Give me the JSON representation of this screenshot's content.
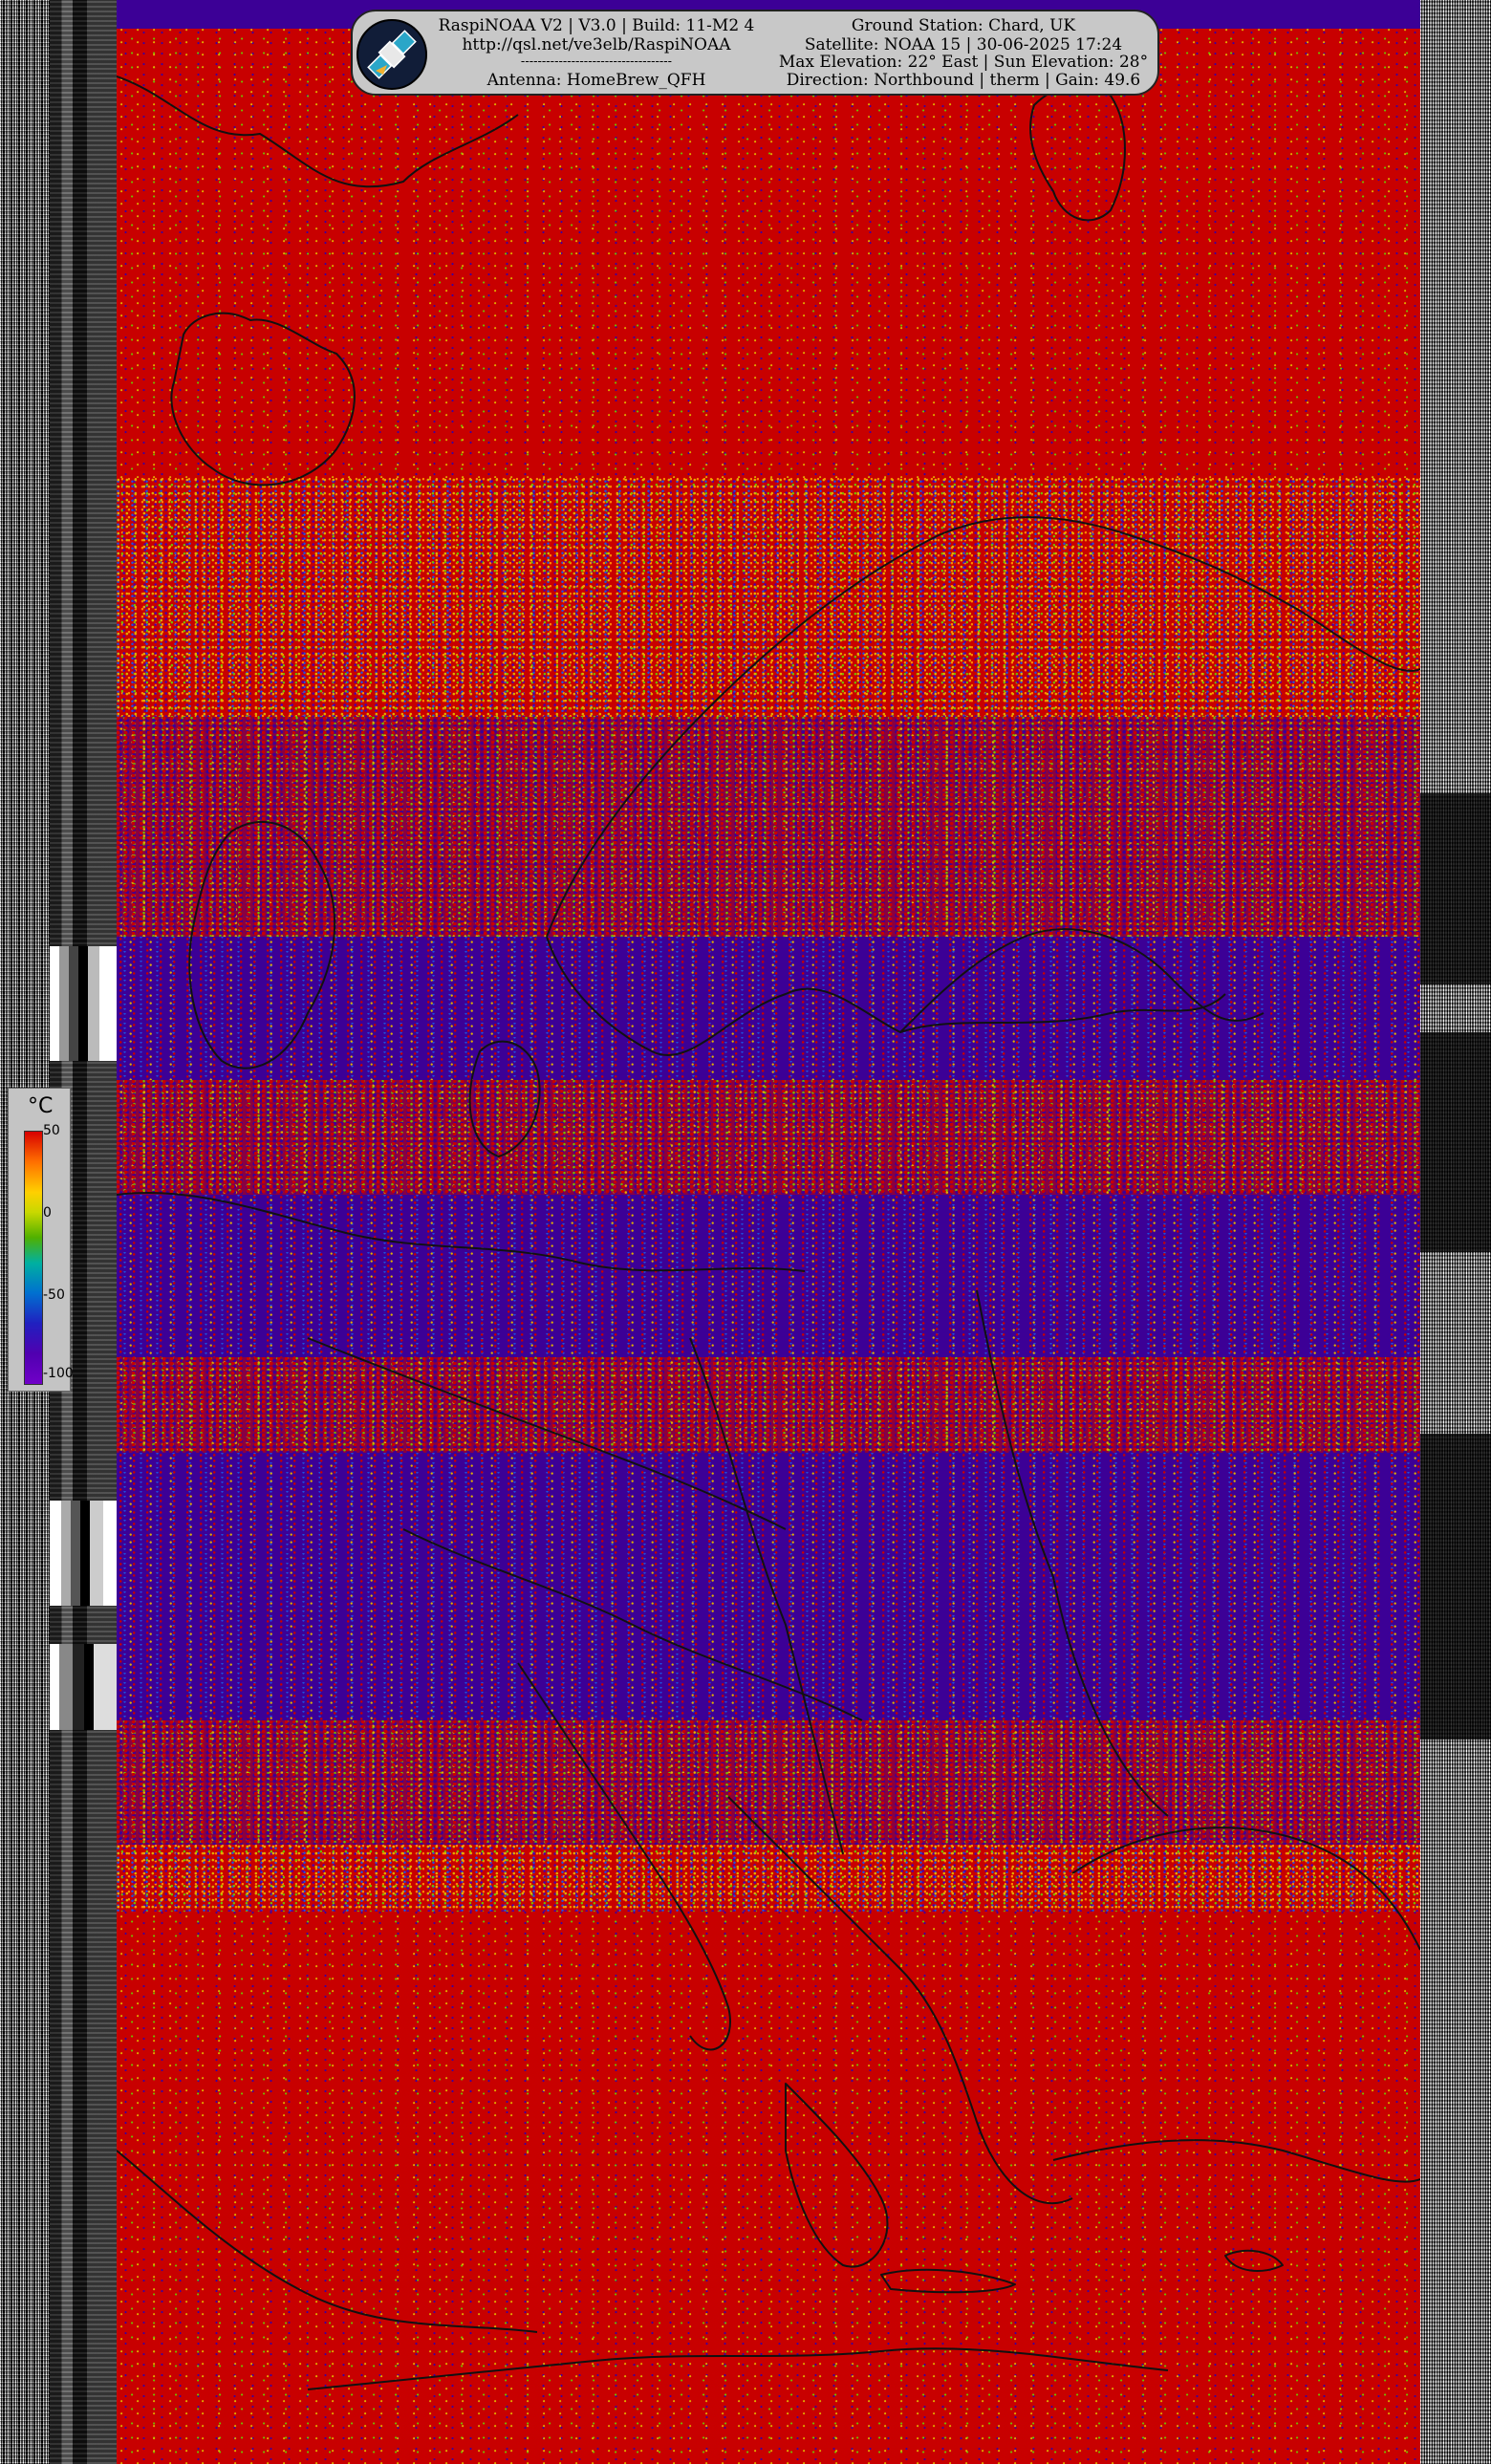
{
  "header": {
    "left_lines": [
      "RaspiNOAA V2 | V3.0 | Build: 11-M2 4",
      "http://qsl.net/ve3elb/RaspiNOAA",
      "------------------------------------",
      "Antenna: HomeBrew_QFH"
    ],
    "right_lines": [
      "Ground Station: Chard, UK",
      "Satellite: NOAA 15 | 30-06-2025 17:24",
      "Max Elevation: 22° East | Sun Elevation: 28°",
      "Direction: Northbound | therm | Gain: 49.6"
    ]
  },
  "legend": {
    "unit": "°C",
    "ticks": [
      "50",
      "0",
      "-50",
      "-100"
    ],
    "colors": [
      "#d80000",
      "#ffd000",
      "#50b000",
      "#0070d0",
      "#7000c8"
    ]
  },
  "palette": {
    "warm": "#c80000",
    "cold": "#3c0096"
  }
}
